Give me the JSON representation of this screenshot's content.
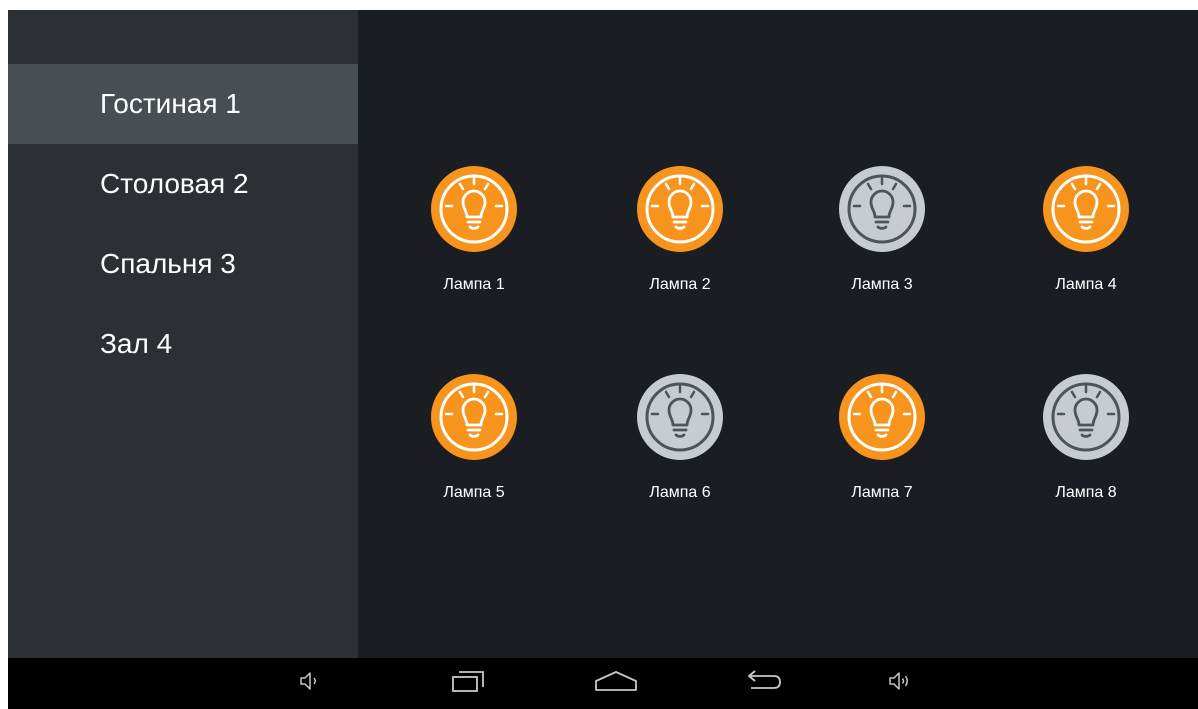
{
  "colors": {
    "lamp_on": "#f7941d",
    "lamp_off": "#c8ccd0",
    "bulb_on": "#ffffff",
    "bulb_off": "#4d545b",
    "sidebar_bg": "#2c3034",
    "sidebar_active": "#484e53",
    "content_bg": "#1a1d21",
    "navbar_bg": "#000000",
    "nav_icon": "#c8c8c8"
  },
  "sidebar": {
    "rooms": [
      {
        "label": "Гостиная 1",
        "active": true
      },
      {
        "label": "Столовая 2",
        "active": false
      },
      {
        "label": "Спальня 3",
        "active": false
      },
      {
        "label": "Зал 4",
        "active": false
      }
    ]
  },
  "lamps": [
    {
      "label": "Лампа 1",
      "state": "on",
      "icon": "lightbulb-icon"
    },
    {
      "label": "Лампа 2",
      "state": "on",
      "icon": "lightbulb-icon"
    },
    {
      "label": "Лампа 3",
      "state": "off",
      "icon": "lightbulb-icon"
    },
    {
      "label": "Лампа 4",
      "state": "on",
      "icon": "lightbulb-icon"
    },
    {
      "label": "Лампа 5",
      "state": "on",
      "icon": "lightbulb-icon"
    },
    {
      "label": "Лампа 6",
      "state": "off",
      "icon": "lightbulb-icon"
    },
    {
      "label": "Лампа 7",
      "state": "on",
      "icon": "lightbulb-icon"
    },
    {
      "label": "Лампа 8",
      "state": "off",
      "icon": "lightbulb-icon"
    }
  ],
  "navbar": {
    "buttons": [
      {
        "icon": "volume-down-icon"
      },
      {
        "icon": "recent-apps-icon"
      },
      {
        "icon": "home-icon"
      },
      {
        "icon": "back-icon"
      },
      {
        "icon": "volume-up-icon"
      }
    ]
  }
}
